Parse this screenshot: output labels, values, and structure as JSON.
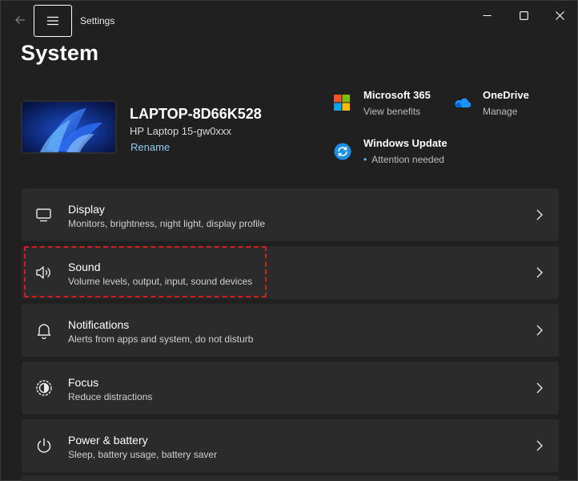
{
  "window": {
    "title": "Settings"
  },
  "page": {
    "title": "System"
  },
  "device": {
    "name": "LAPTOP-8D66K528",
    "model": "HP Laptop 15-gw0xxx",
    "rename_label": "Rename"
  },
  "quick_links": [
    {
      "title": "Microsoft 365",
      "subtitle": "View benefits",
      "icon": "microsoft-365-icon"
    },
    {
      "title": "OneDrive",
      "subtitle": "Manage",
      "icon": "onedrive-icon"
    },
    {
      "title": "Windows Update",
      "subtitle": "Attention needed",
      "icon": "windows-update-icon",
      "status_dot": "•"
    }
  ],
  "settings": [
    {
      "title": "Display",
      "subtitle": "Monitors, brightness, night light, display profile",
      "icon": "display-icon"
    },
    {
      "title": "Sound",
      "subtitle": "Volume levels, output, input, sound devices",
      "icon": "speaker-icon",
      "highlighted": true
    },
    {
      "title": "Notifications",
      "subtitle": "Alerts from apps and system, do not disturb",
      "icon": "bell-icon"
    },
    {
      "title": "Focus",
      "subtitle": "Reduce distractions",
      "icon": "focus-icon"
    },
    {
      "title": "Power & battery",
      "subtitle": "Sleep, battery usage, battery saver",
      "icon": "power-icon"
    }
  ],
  "colors": {
    "background": "#202020",
    "card": "#2b2b2b",
    "accent_link": "#8fc8f0",
    "highlight_border": "#d41e1e",
    "status_dot": "#4cc2ff"
  }
}
